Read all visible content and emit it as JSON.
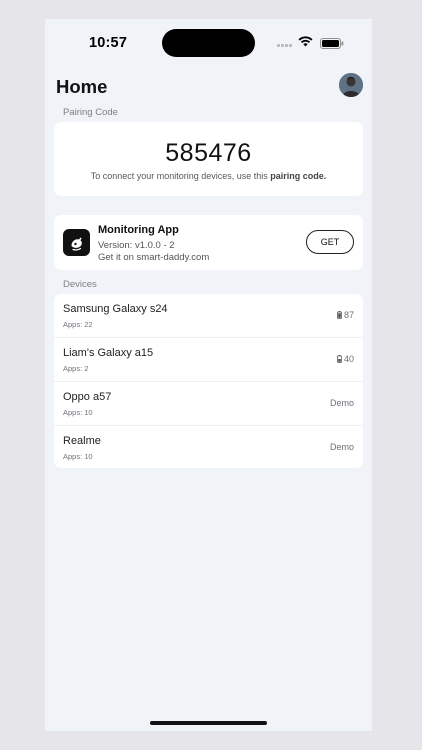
{
  "status_bar": {
    "time": "10:57",
    "icons": [
      "cellular-signal-icon",
      "wifi-icon",
      "battery-icon"
    ]
  },
  "header": {
    "title": "Home",
    "avatar_icon": "avatar"
  },
  "pairing": {
    "section_label": "Pairing Code",
    "code": "585476",
    "description_prefix": "To connect your monitoring devices, use this ",
    "description_bold": "pairing code."
  },
  "app_card": {
    "icon": "monitoring-app-icon",
    "name": "Monitoring App",
    "version": "Version: v1.0.0 - 2",
    "site": "Get it on smart-daddy.com",
    "button_label": "GET"
  },
  "devices": {
    "section_label": "Devices",
    "items": [
      {
        "name": "Samsung Galaxy s24",
        "apps": "Apps: 22",
        "status": "87",
        "status_icon": "battery-icon"
      },
      {
        "name": "Liam's Galaxy a15",
        "apps": "Apps: 2",
        "status": "40",
        "status_icon": "battery-icon"
      },
      {
        "name": "Oppo a57",
        "apps": "Apps: 10",
        "status": "Demo",
        "status_icon": ""
      },
      {
        "name": "Realme",
        "apps": "Apps: 10",
        "status": "Demo",
        "status_icon": ""
      }
    ]
  },
  "colors": {
    "background": "#e5e5ea",
    "screen": "#f0f3f8",
    "card": "#ffffff",
    "text": "#111111",
    "muted": "#6b6f76"
  }
}
